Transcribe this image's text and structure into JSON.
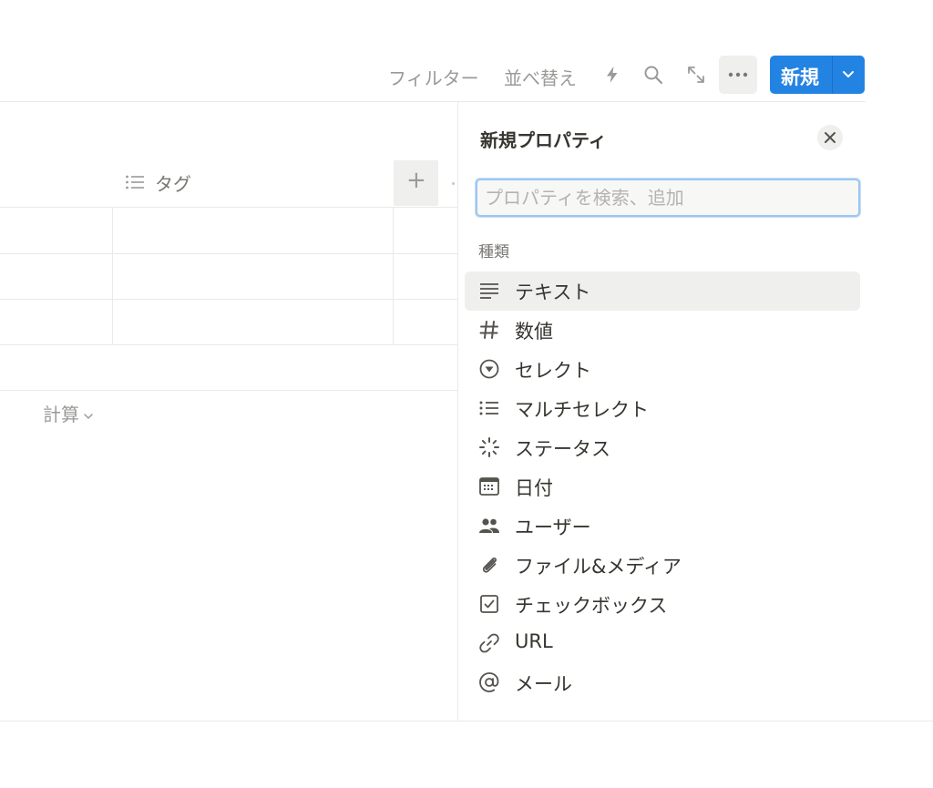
{
  "toolbar": {
    "filter_label": "フィルター",
    "sort_label": "並べ替え",
    "automation_icon": "lightning-icon",
    "search_icon": "search-icon",
    "expand_icon": "expand-icon",
    "more_icon": "more-icon",
    "new_label": "新規",
    "accent_color": "#2383e2"
  },
  "table": {
    "column_header": "タグ",
    "add_column": "+",
    "calculate_label": "計算"
  },
  "panel": {
    "title": "新規プロパティ",
    "search_placeholder": "プロパティを検索、追加",
    "section_label": "種類",
    "types": [
      {
        "label": "テキスト",
        "icon": "text-lines-icon"
      },
      {
        "label": "数値",
        "icon": "hash-icon"
      },
      {
        "label": "セレクト",
        "icon": "select-circle-icon"
      },
      {
        "label": "マルチセレクト",
        "icon": "list-icon"
      },
      {
        "label": "ステータス",
        "icon": "status-spinner-icon"
      },
      {
        "label": "日付",
        "icon": "calendar-icon"
      },
      {
        "label": "ユーザー",
        "icon": "people-icon"
      },
      {
        "label": "ファイル&メディア",
        "icon": "paperclip-icon"
      },
      {
        "label": "チェックボックス",
        "icon": "checkbox-icon"
      },
      {
        "label": "URL",
        "icon": "link-icon"
      },
      {
        "label": "メール",
        "icon": "at-icon"
      }
    ]
  }
}
